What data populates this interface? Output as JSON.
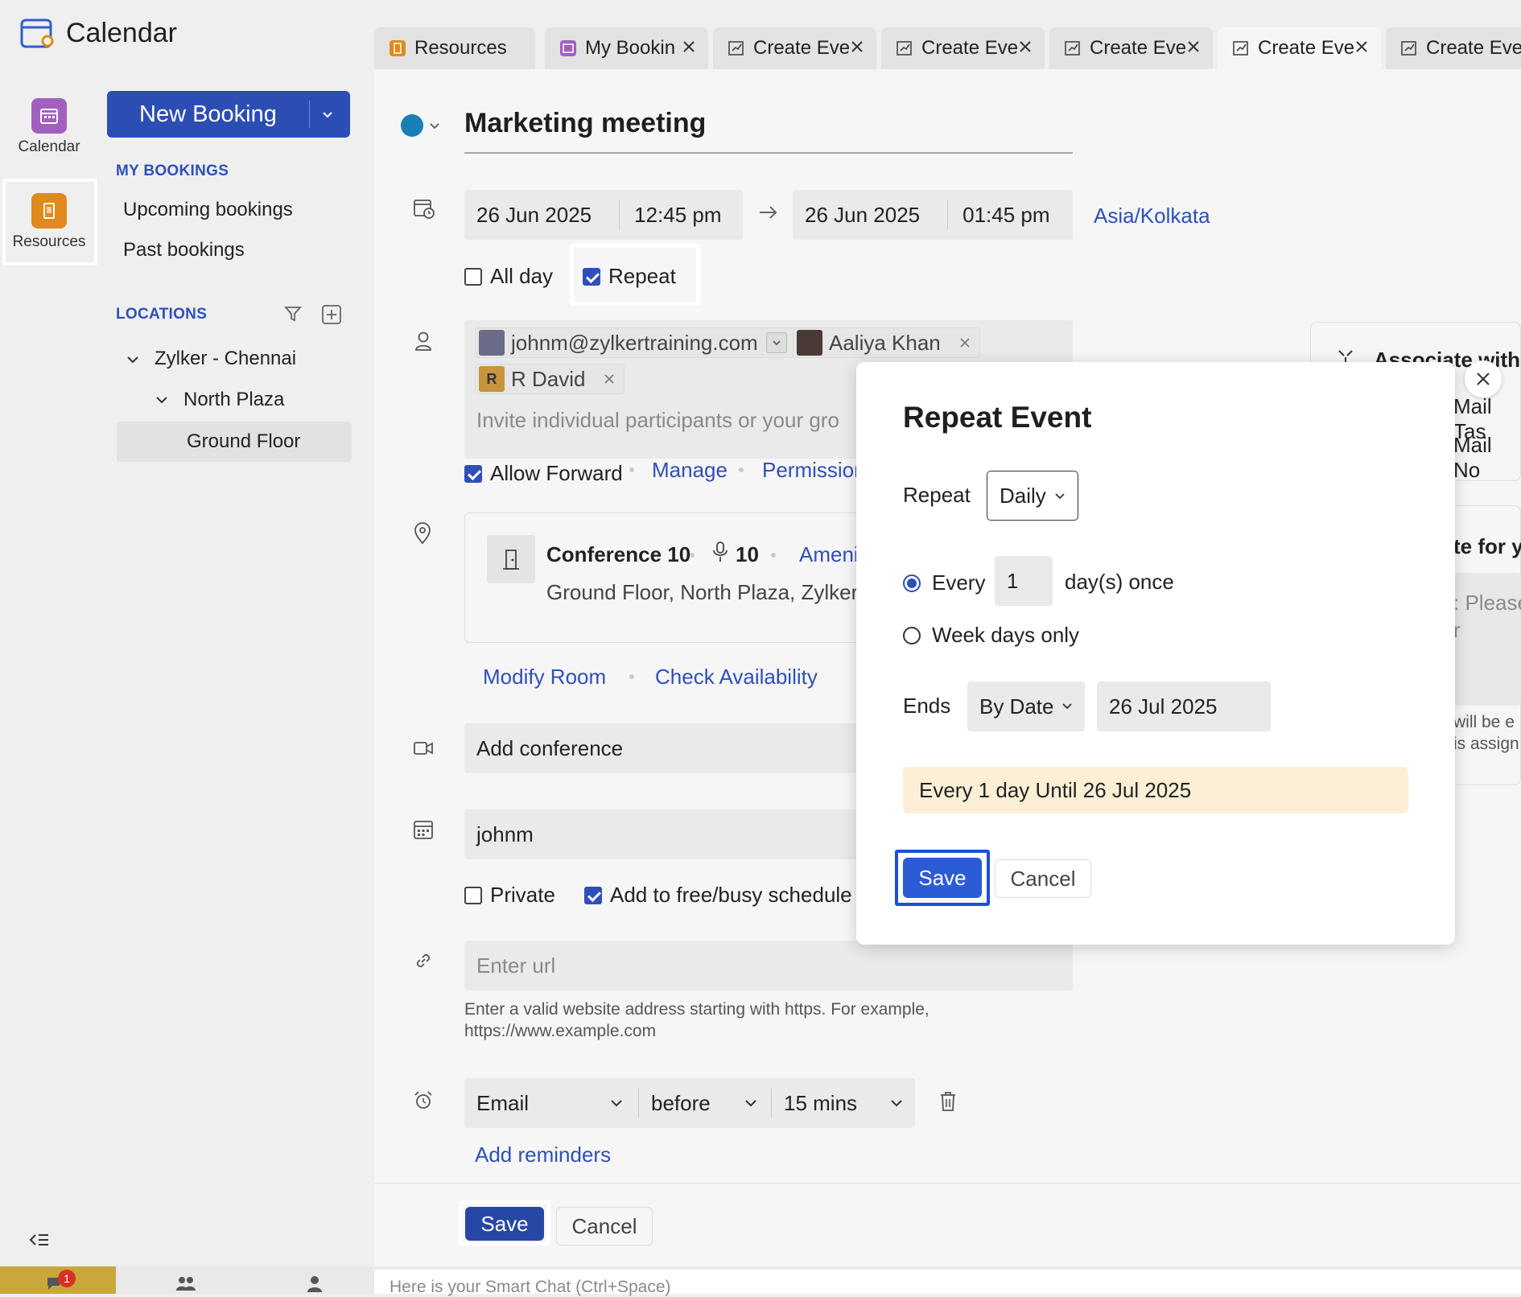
{
  "app": {
    "title": "Calendar"
  },
  "rail": {
    "items": [
      {
        "label": "Calendar",
        "icon": "calendar-icon",
        "color": "#9b59b6"
      },
      {
        "label": "Resources",
        "icon": "resources-icon",
        "color": "#e08a1e"
      }
    ]
  },
  "sidebar": {
    "new_booking": "New Booking",
    "my_bookings_heading": "MY BOOKINGS",
    "bookings": [
      "Upcoming bookings",
      "Past bookings"
    ],
    "locations_heading": "LOCATIONS",
    "tree": [
      {
        "label": "Zylker - Chennai"
      },
      {
        "label": "North Plaza"
      },
      {
        "label": "Ground Floor",
        "selected": true
      }
    ]
  },
  "tabs": [
    {
      "label": "Resources",
      "icon": "resources-tab-icon"
    },
    {
      "label": "My Bookin",
      "icon": "calendar-tab-icon"
    },
    {
      "label": "Create Eve",
      "icon": "create-event-icon"
    },
    {
      "label": "Create Eve",
      "icon": "create-event-icon"
    },
    {
      "label": "Create Eve",
      "icon": "create-event-icon"
    },
    {
      "label": "Create Eve",
      "icon": "create-event-icon",
      "active": true
    },
    {
      "label": "Create Eve",
      "icon": "create-event-icon"
    }
  ],
  "event": {
    "color": "#1a7fb5",
    "title": "Marketing meeting",
    "start_date": "26 Jun 2025",
    "start_time": "12:45 pm",
    "end_date": "26 Jun 2025",
    "end_time": "01:45 pm",
    "timezone": "Asia/Kolkata",
    "all_day_label": "All day",
    "repeat_label": "Repeat",
    "participants": [
      {
        "label": "johnm@zylkertraining.com"
      },
      {
        "label": "Aaliya Khan"
      },
      {
        "label": "R David",
        "initial": "R"
      }
    ],
    "invite_placeholder": "Invite individual participants or your gro",
    "allow_forward_label": "Allow Forward",
    "manage_label": "Manage",
    "permission_label": "Permission",
    "room": {
      "name": "Conference 10",
      "capacity": "10",
      "amenities_label": "Ameni",
      "address": "Ground Floor, North Plaza, Zylker -"
    },
    "modify_room": "Modify Room",
    "check_availability": "Check Availability",
    "conference_label": "Add conference",
    "calendar_value": "johnm",
    "private_label": "Private",
    "free_busy_label": "Add to free/busy schedule",
    "url_placeholder": "Enter url",
    "url_hint_1": "Enter a valid website address starting with https. For example,",
    "url_hint_2": "https://www.example.com",
    "reminder": {
      "type": "Email",
      "when": "before",
      "duration": "15 mins"
    },
    "add_reminders": "Add reminders",
    "save": "Save",
    "cancel": "Cancel"
  },
  "right_panel": {
    "associate": "Associate with",
    "mail_task": "Mail Tas",
    "mail_note": "Mail No",
    "note_heading": "te for yo",
    "note_placeholder_1": ": Please",
    "note_placeholder_2": "r",
    "note_hint_1": "will be e",
    "note_hint_2": "is assign"
  },
  "modal": {
    "title": "Repeat Event",
    "repeat_label": "Repeat",
    "repeat_value": "Daily",
    "every_label": "Every",
    "every_value": "1",
    "every_suffix": "day(s) once",
    "weekdays_label": "Week days only",
    "ends_label": "Ends",
    "ends_mode": "By Date",
    "ends_date": "26 Jul 2025",
    "summary": "Every 1 day Until 26 Jul 2025",
    "save": "Save",
    "cancel": "Cancel"
  },
  "bottom": {
    "chat_badge": "1",
    "smart_chat_placeholder": "Here is your Smart Chat (Ctrl+Space)"
  }
}
